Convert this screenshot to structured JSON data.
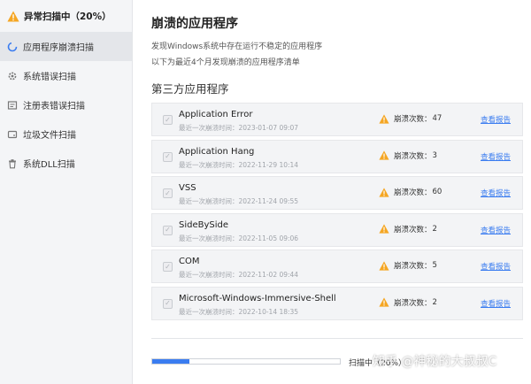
{
  "sidebar": {
    "status_title": "异常扫描中（20%）",
    "items": [
      {
        "label": "应用程序崩溃扫描",
        "icon": "spinner-icon",
        "active": true
      },
      {
        "label": "系统错误扫描",
        "icon": "gear-icon",
        "active": false
      },
      {
        "label": "注册表错误扫描",
        "icon": "registry-icon",
        "active": false
      },
      {
        "label": "垃圾文件扫描",
        "icon": "disk-icon",
        "active": false
      },
      {
        "label": "系统DLL扫描",
        "icon": "trash-icon",
        "active": false
      }
    ]
  },
  "main": {
    "title": "崩溃的应用程序",
    "description_line1": "发现Windows系统中存在运行不稳定的应用程序",
    "description_line2": "以下为最近4个月发现崩溃的应用程序清单",
    "section_title": "第三方应用程序",
    "crash_label": "崩溃次数：",
    "report_label": "查看报告",
    "apps": [
      {
        "name": "Application Error",
        "last_crash": "最近一次崩溃时间：2023-01-07 09:07",
        "count": "47"
      },
      {
        "name": "Application Hang",
        "last_crash": "最近一次崩溃时间：2022-11-29 10:14",
        "count": "3"
      },
      {
        "name": "VSS",
        "last_crash": "最近一次崩溃时间：2022-11-24 09:55",
        "count": "60"
      },
      {
        "name": "SideBySide",
        "last_crash": "最近一次崩溃时间：2022-11-05 09:06",
        "count": "2"
      },
      {
        "name": "COM",
        "last_crash": "最近一次崩溃时间：2022-11-02 09:44",
        "count": "5"
      },
      {
        "name": "Microsoft-Windows-Immersive-Shell",
        "last_crash": "最近一次崩溃时间：2022-10-14 18:35",
        "count": "2"
      }
    ]
  },
  "footer": {
    "progress_percent": 20,
    "progress_text": "扫描中（20%）",
    "watermark": "知乎 @神秘的大叔叔C"
  },
  "colors": {
    "accent": "#3a7cf0",
    "warning": "#f5a623"
  }
}
